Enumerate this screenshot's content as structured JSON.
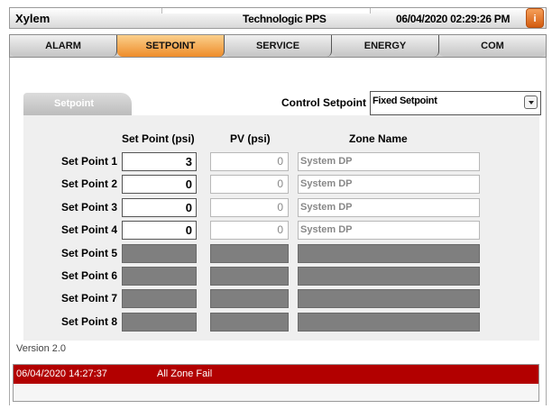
{
  "titlebar": {
    "app": "Xylem",
    "title": "Technologic PPS",
    "datetime": "06/04/2020 02:29:26 PM",
    "info_icon": "info-icon"
  },
  "nav": {
    "tabs": [
      {
        "label": "ALARM",
        "active": false
      },
      {
        "label": "SETPOINT",
        "active": true
      },
      {
        "label": "SERVICE",
        "active": false
      },
      {
        "label": "ENERGY",
        "active": false
      },
      {
        "label": "COM",
        "active": false
      }
    ]
  },
  "section": {
    "tab_label": "Setpoint"
  },
  "control": {
    "label": "Control Setpoint",
    "value": "Fixed Setpoint"
  },
  "table": {
    "headers": {
      "setpoint": "Set Point (psi)",
      "pv": "PV (psi)",
      "zone": "Zone Name"
    },
    "rows": [
      {
        "label": "Set Point 1",
        "setpoint": "3",
        "pv": "0",
        "zone": "System DP",
        "enabled": true
      },
      {
        "label": "Set Point 2",
        "setpoint": "0",
        "pv": "0",
        "zone": "System DP",
        "enabled": true
      },
      {
        "label": "Set Point 3",
        "setpoint": "0",
        "pv": "0",
        "zone": "System DP",
        "enabled": true
      },
      {
        "label": "Set Point 4",
        "setpoint": "0",
        "pv": "0",
        "zone": "System DP",
        "enabled": true
      },
      {
        "label": "Set Point 5",
        "setpoint": "",
        "pv": "",
        "zone": "",
        "enabled": false
      },
      {
        "label": "Set Point 6",
        "setpoint": "",
        "pv": "",
        "zone": "",
        "enabled": false
      },
      {
        "label": "Set Point 7",
        "setpoint": "",
        "pv": "",
        "zone": "",
        "enabled": false
      },
      {
        "label": "Set Point 8",
        "setpoint": "",
        "pv": "",
        "zone": "",
        "enabled": false
      }
    ]
  },
  "version": "Version 2.0",
  "alarm": {
    "time": "06/04/2020 14:27:37",
    "message": "All Zone Fail",
    "color": "#b20000"
  },
  "colors": {
    "active_tab": "#ee8c2a",
    "disabled_field": "#7f7f7f"
  }
}
